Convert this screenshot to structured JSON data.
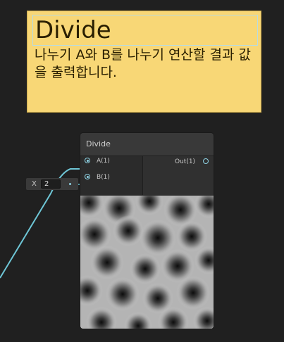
{
  "sticky_note": {
    "title": "Divide",
    "body": "나누기 A와 B를 나누기 연산할 결과 값을 출력합니다."
  },
  "node": {
    "title": "Divide",
    "inputs": [
      "A(1)",
      "B(1)"
    ],
    "outputs": [
      "Out(1)"
    ]
  },
  "x_field": {
    "label": "X",
    "value": "2"
  },
  "colors": {
    "background": "#202020",
    "sticky": "#f8d776",
    "wire": "#6ec6d6",
    "node_body": "#2f2f2f"
  }
}
